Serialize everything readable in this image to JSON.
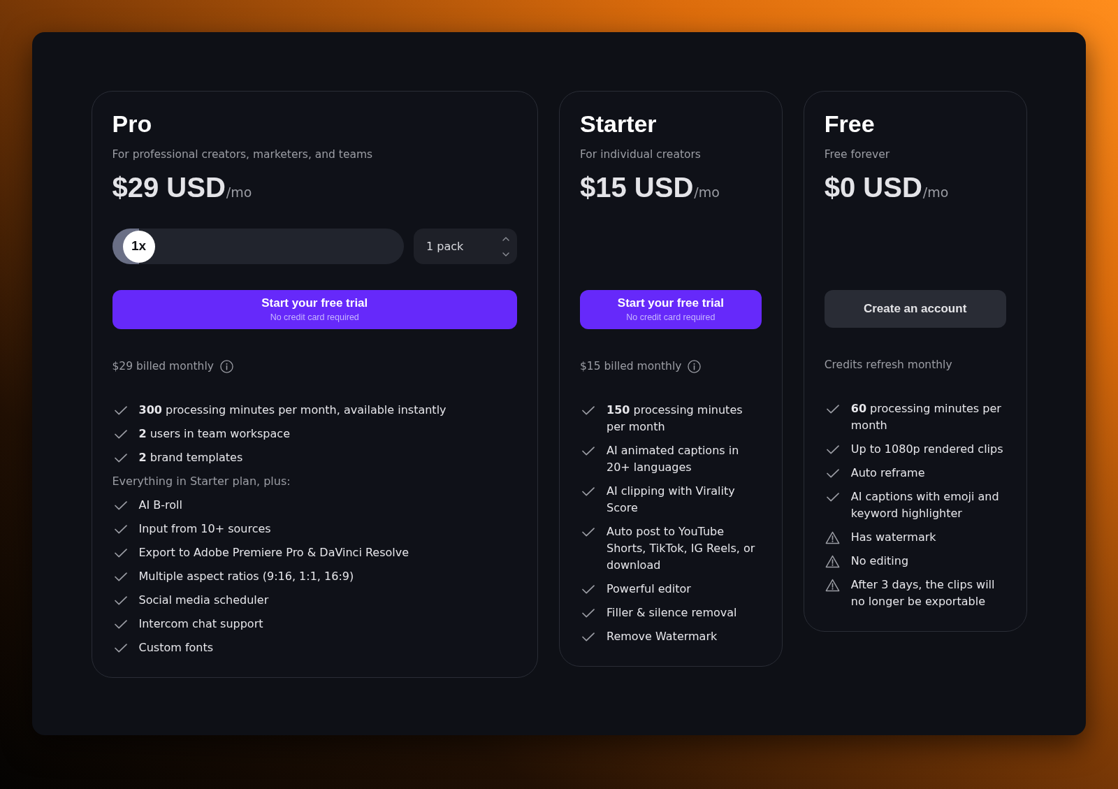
{
  "plans": [
    {
      "name": "Pro",
      "tagline": "For professional creators, marketers, and teams",
      "price": "$29 USD",
      "period": "/mo",
      "quantity": {
        "multiplier": "1x",
        "level": 0,
        "pack": "1 pack"
      },
      "cta": {
        "kind": "primary",
        "label": "Start your free trial",
        "sublabel": "No credit card required"
      },
      "note": {
        "text": "$29 billed monthly",
        "info_icon": true
      },
      "features": [
        {
          "kind": "check",
          "text": "**300** processing minutes per month, available instantly"
        },
        {
          "kind": "check",
          "text": "**2** users in team workspace"
        },
        {
          "kind": "check",
          "text": "**2** brand templates"
        },
        {
          "kind": "heading",
          "text": "Everything in Starter plan, plus:"
        },
        {
          "kind": "check",
          "text": "AI B-roll"
        },
        {
          "kind": "check",
          "text": "Input from 10+ sources"
        },
        {
          "kind": "check",
          "text": "Export to Adobe Premiere Pro & DaVinci Resolve"
        },
        {
          "kind": "check",
          "text": "Multiple aspect ratios (9:16, 1:1, 16:9)"
        },
        {
          "kind": "check",
          "text": "Social media scheduler"
        },
        {
          "kind": "check",
          "text": "Intercom chat support"
        },
        {
          "kind": "check",
          "text": "Custom fonts"
        }
      ]
    },
    {
      "name": "Starter",
      "tagline": "For individual creators",
      "price": "$15 USD",
      "period": "/mo",
      "cta": {
        "kind": "primary",
        "label": "Start your free trial",
        "sublabel": "No credit card required"
      },
      "note": {
        "text": "$15 billed monthly",
        "info_icon": true
      },
      "features": [
        {
          "kind": "check",
          "text": "**150** processing minutes per month"
        },
        {
          "kind": "check",
          "text": "AI animated captions in 20+ languages"
        },
        {
          "kind": "check",
          "text": "AI clipping with Virality Score"
        },
        {
          "kind": "check",
          "text": "Auto post to YouTube Shorts, TikTok, IG Reels, or download"
        },
        {
          "kind": "check",
          "text": "Powerful editor"
        },
        {
          "kind": "check",
          "text": "Filler & silence removal"
        },
        {
          "kind": "check",
          "text": "Remove Watermark"
        }
      ]
    },
    {
      "name": "Free",
      "tagline": "Free forever",
      "price": "$0 USD",
      "period": "/mo",
      "cta": {
        "kind": "secondary",
        "label": "Create an account"
      },
      "note": {
        "text": "Credits refresh monthly",
        "info_icon": false
      },
      "features": [
        {
          "kind": "check",
          "text": "**60** processing minutes per month"
        },
        {
          "kind": "check",
          "text": "Up to 1080p rendered clips"
        },
        {
          "kind": "check",
          "text": "Auto reframe"
        },
        {
          "kind": "check",
          "text": "AI captions with emoji and keyword highlighter"
        },
        {
          "kind": "warning",
          "text": "Has watermark"
        },
        {
          "kind": "warning",
          "text": "No editing"
        },
        {
          "kind": "warning",
          "text": "After 3 days, the clips will no longer be exportable"
        }
      ]
    }
  ]
}
